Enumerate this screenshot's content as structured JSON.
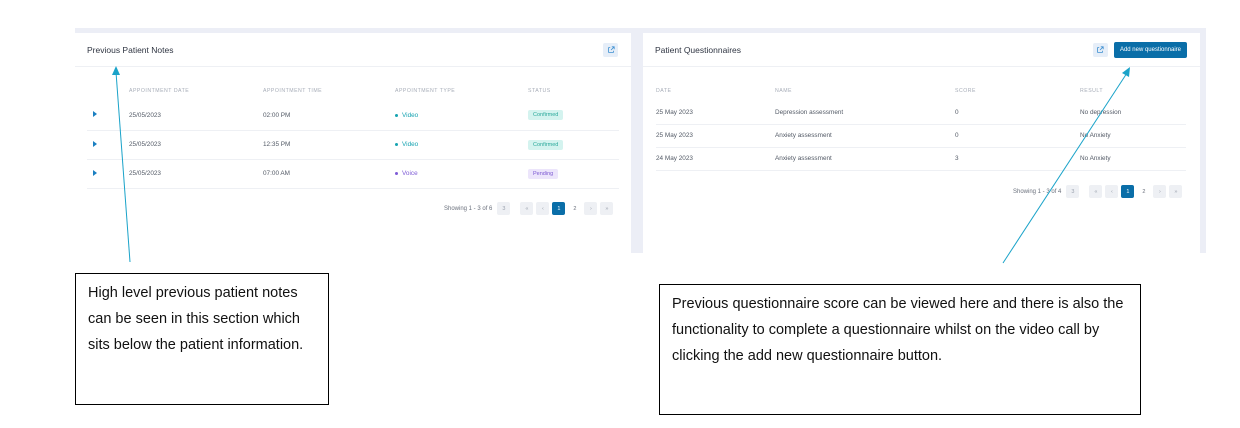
{
  "notes_card": {
    "title": "Previous Patient Notes",
    "columns": [
      "APPOINTMENT DATE",
      "APPOINTMENT TIME",
      "APPOINTMENT TYPE",
      "STATUS"
    ],
    "rows": [
      {
        "date": "25/05/2023",
        "time": "02:00 PM",
        "type": "Video",
        "status": "Confirmed"
      },
      {
        "date": "25/05/2023",
        "time": "12:35 PM",
        "type": "Video",
        "status": "Confirmed"
      },
      {
        "date": "25/05/2023",
        "time": "07:00 AM",
        "type": "Voice",
        "status": "Pending"
      }
    ],
    "pagination": {
      "showing": "Showing 1 - 3 of 6",
      "page_size": "3",
      "first": "«",
      "prev": "‹",
      "pages": [
        "1",
        "2"
      ],
      "next": "›",
      "last": "»"
    }
  },
  "questionnaire_card": {
    "title": "Patient Questionnaires",
    "add_button": "Add new questionnaire",
    "columns": [
      "DATE",
      "NAME",
      "SCORE",
      "RESULT"
    ],
    "rows": [
      {
        "date": "25 May 2023",
        "name": "Depression assessment",
        "score": "0",
        "result": "No depression"
      },
      {
        "date": "25 May 2023",
        "name": "Anxiety assessment",
        "score": "0",
        "result": "No Anxiety"
      },
      {
        "date": "24 May 2023",
        "name": "Anxiety assessment",
        "score": "3",
        "result": "No Anxiety"
      }
    ],
    "pagination": {
      "showing": "Showing 1 - 3 of 4",
      "page_size": "3",
      "first": "«",
      "prev": "‹",
      "pages": [
        "1",
        "2"
      ],
      "next": "›",
      "last": "»"
    }
  },
  "annotations": {
    "left": "High level previous patient notes can be seen in this section which sits below the patient information.",
    "right": "Previous questionnaire score can be viewed here and there is also the functionality to complete a questionnaire whilst on the video call by clicking the add new questionnaire button."
  },
  "colors": {
    "accent": "#0a6ea8",
    "video": "#16a3b1",
    "voice": "#7e5bd6",
    "arrow": "#1aa3c9"
  },
  "icons": [
    "external-link-icon",
    "expand-caret-icon"
  ]
}
